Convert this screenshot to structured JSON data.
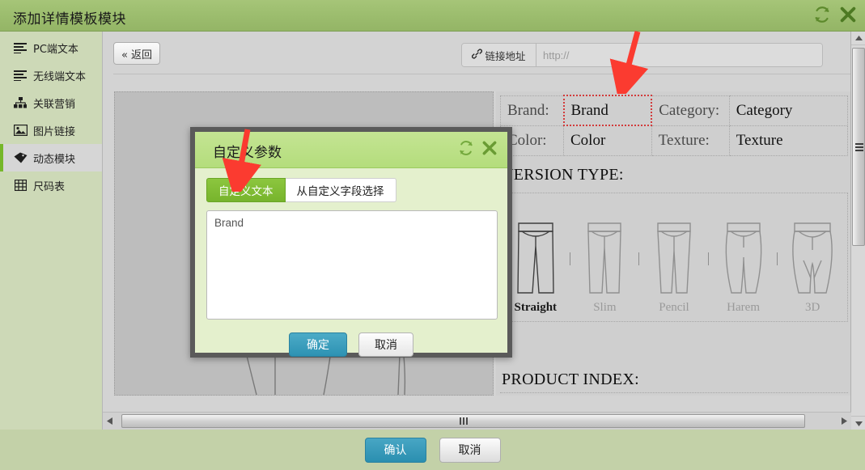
{
  "window": {
    "title": "添加详情模板模块",
    "refresh_icon": "refresh-icon",
    "close_icon": "close-icon"
  },
  "sidebar": {
    "items": [
      {
        "label": "PC端文本",
        "icon": "text-lines-icon",
        "active": false
      },
      {
        "label": "无线端文本",
        "icon": "text-lines-icon",
        "active": false
      },
      {
        "label": "关联营销",
        "icon": "sitemap-icon",
        "active": false
      },
      {
        "label": "图片链接",
        "icon": "image-icon",
        "active": false
      },
      {
        "label": "动态模块",
        "icon": "tag-icon",
        "active": true
      },
      {
        "label": "尺码表",
        "icon": "table-grid-icon",
        "active": false
      }
    ]
  },
  "toolbar": {
    "back_label": "« 返回",
    "link_label": "链接地址",
    "link_icon": "link-chain-icon",
    "link_value": "",
    "link_placeholder": "http://"
  },
  "spec_table": {
    "rows": [
      {
        "label1": "Brand:",
        "value1": "Brand",
        "selected1": true,
        "label2": "Category:",
        "value2": "Category",
        "selected2": false
      },
      {
        "label1": "Color:",
        "value1": "Color",
        "selected1": false,
        "label2": "Texture:",
        "value2": "Texture",
        "selected2": false
      }
    ]
  },
  "version_section": {
    "title": "VERSION TYPE:",
    "items": [
      {
        "label": "Straight",
        "active": true
      },
      {
        "label": "Slim",
        "active": false
      },
      {
        "label": "Pencil",
        "active": false
      },
      {
        "label": "Harem",
        "active": false
      },
      {
        "label": "3D",
        "active": false
      }
    ]
  },
  "product_index": {
    "title": "PRODUCT INDEX:"
  },
  "modal": {
    "title": "自定义参数",
    "refresh_icon": "refresh-icon",
    "close_icon": "close-icon",
    "tabs": [
      {
        "label": "自定义文本",
        "active": true
      },
      {
        "label": "从自定义字段选择",
        "active": false
      }
    ],
    "textarea_value": "Brand",
    "confirm_label": "确定",
    "cancel_label": "取消"
  },
  "footer": {
    "confirm_label": "确认",
    "cancel_label": "取消"
  },
  "colors": {
    "header_green": "#9cbd6e",
    "modal_header_green": "#b4dd7c",
    "accent_blue": "#2d92b3",
    "tab_active_green": "#77b42c",
    "selection_red": "#d23b3b",
    "page_bg": "#c3d1a8",
    "panel_bg": "#d3d3d3"
  },
  "annotations": {
    "arrow_top": "red-arrow-down",
    "arrow_modal": "red-arrow-down"
  }
}
